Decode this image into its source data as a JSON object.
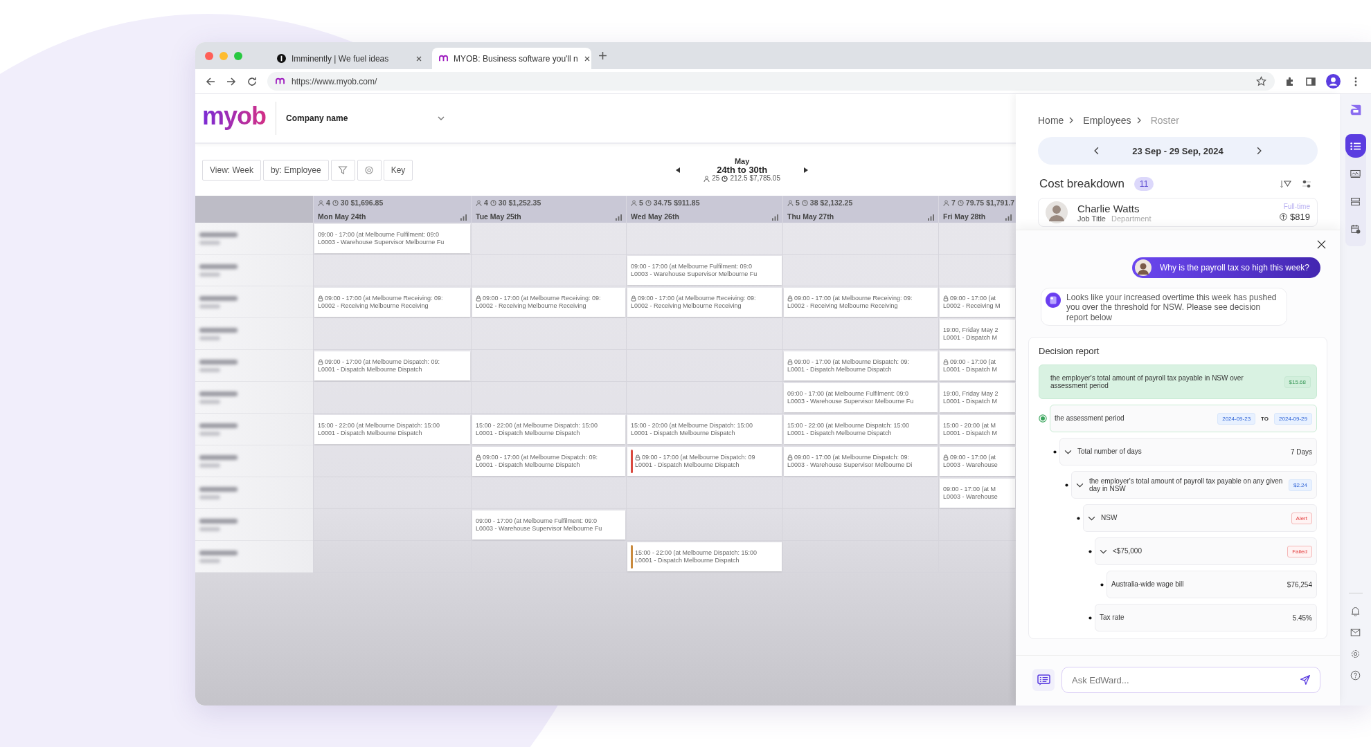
{
  "browser": {
    "tabs": [
      {
        "title": "Imminently | We fuel ideas",
        "selected": false
      },
      {
        "title": "MYOB: Business software you'll n",
        "selected": true
      }
    ],
    "url": "https://www.myob.com/"
  },
  "app": {
    "logo": "myob",
    "company": "Company name",
    "toolbar": {
      "view": "View: Week",
      "group": "by: Employee",
      "key": "Key",
      "month": "May",
      "range": "24th to 30th",
      "people": "25",
      "hours": "212.5",
      "cost": "$7,785.05"
    },
    "days": [
      {
        "people": "4",
        "hours": "30",
        "cost": "$1,696.85",
        "label": "Mon May 24th"
      },
      {
        "people": "4",
        "hours": "30",
        "cost": "$1,252.35",
        "label": "Tue May 25th"
      },
      {
        "people": "5",
        "hours": "34.75",
        "cost": "$911.85",
        "label": "Wed May 26th"
      },
      {
        "people": "5",
        "hours": "38",
        "cost": "$2,132.25",
        "label": "Thu May 27th"
      },
      {
        "people": "7",
        "hours": "79.75",
        "cost": "$1,791.7",
        "label": "Fri May 28th"
      }
    ],
    "rows": [
      {
        "cells": [
          {
            "kind": "shift",
            "locked": false,
            "line1": "09:00 - 17:00 (at Melbourne Fulfilment: 09:0",
            "line2": "L0003 - Warehouse Supervisor Melbourne Fu"
          },
          {
            "kind": "empty"
          },
          {
            "kind": "empty"
          },
          {
            "kind": "empty"
          },
          {
            "kind": "empty"
          }
        ]
      },
      {
        "cells": [
          {
            "kind": "empty"
          },
          {
            "kind": "empty"
          },
          {
            "kind": "shift",
            "locked": false,
            "line1": "09:00 - 17:00 (at Melbourne Fulfilment: 09:0",
            "line2": "L0003 - Warehouse Supervisor Melbourne Fu"
          },
          {
            "kind": "empty"
          },
          {
            "kind": "empty"
          }
        ]
      },
      {
        "cells": [
          {
            "kind": "shift",
            "locked": true,
            "line1": "09:00 - 17:00 (at Melbourne Receiving: 09:",
            "line2": "L0002 - Receiving Melbourne Receiving"
          },
          {
            "kind": "shift",
            "locked": true,
            "line1": "09:00 - 17:00 (at Melbourne Receiving: 09:",
            "line2": "L0002 - Receiving Melbourne Receiving"
          },
          {
            "kind": "shift",
            "locked": true,
            "line1": "09:00 - 17:00 (at Melbourne Receiving: 09:",
            "line2": "L0002 - Receiving Melbourne Receiving"
          },
          {
            "kind": "shift",
            "locked": true,
            "line1": "09:00 - 17:00 (at Melbourne Receiving: 09:",
            "line2": "L0002 - Receiving Melbourne Receiving"
          },
          {
            "kind": "shift",
            "locked": true,
            "line1": "09:00 - 17:00 (at",
            "line2": "L0002 - Receiving M"
          }
        ]
      },
      {
        "cells": [
          {
            "kind": "empty"
          },
          {
            "kind": "empty"
          },
          {
            "kind": "empty"
          },
          {
            "kind": "empty"
          },
          {
            "kind": "shift",
            "locked": false,
            "line1": "19:00, Friday May 2",
            "line2": "L0001 - Dispatch M"
          }
        ]
      },
      {
        "cells": [
          {
            "kind": "shift",
            "locked": true,
            "line1": "09:00 - 17:00 (at Melbourne Dispatch: 09:",
            "line2": "L0001 - Dispatch Melbourne Dispatch"
          },
          {
            "kind": "empty"
          },
          {
            "kind": "empty"
          },
          {
            "kind": "shift",
            "locked": true,
            "line1": "09:00 - 17:00 (at Melbourne Dispatch: 09:",
            "line2": "L0001 - Dispatch Melbourne Dispatch"
          },
          {
            "kind": "shift",
            "locked": true,
            "line1": "09:00 - 17:00 (at",
            "line2": "L0001 - Dispatch M"
          }
        ]
      },
      {
        "cells": [
          {
            "kind": "empty"
          },
          {
            "kind": "empty"
          },
          {
            "kind": "empty"
          },
          {
            "kind": "shift",
            "locked": false,
            "line1": "09:00 - 17:00 (at Melbourne Fulfilment: 09:0",
            "line2": "L0003 - Warehouse Supervisor Melbourne Fu"
          },
          {
            "kind": "shift",
            "locked": false,
            "line1": "19:00, Friday May 2",
            "line2": "L0001 - Dispatch M"
          }
        ]
      },
      {
        "cells": [
          {
            "kind": "shift",
            "locked": false,
            "line1": "15:00 - 22:00 (at Melbourne Dispatch: 15:00",
            "line2": "L0001 - Dispatch Melbourne Dispatch"
          },
          {
            "kind": "shift",
            "locked": false,
            "line1": "15:00 - 22:00 (at Melbourne Dispatch: 15:00",
            "line2": "L0001 - Dispatch Melbourne Dispatch"
          },
          {
            "kind": "shift",
            "locked": false,
            "line1": "15:00 - 20:00 (at Melbourne Dispatch: 15:00",
            "line2": "L0001 - Dispatch Melbourne Dispatch"
          },
          {
            "kind": "shift",
            "locked": false,
            "line1": "15:00 - 22:00 (at Melbourne Dispatch: 15:00",
            "line2": "L0001 - Dispatch Melbourne Dispatch"
          },
          {
            "kind": "shift",
            "locked": false,
            "line1": "15:00 - 20:00 (at M",
            "line2": "L0001 - Dispatch M"
          }
        ]
      },
      {
        "cells": [
          {
            "kind": "empty"
          },
          {
            "kind": "shift",
            "locked": true,
            "line1": "09:00 - 17:00 (at Melbourne Dispatch: 09:",
            "line2": "L0001 - Dispatch Melbourne Dispatch"
          },
          {
            "kind": "shift",
            "locked": true,
            "color": "#d9493f",
            "line1": "09:00 - 17:00 (at Melbourne Dispatch: 09",
            "line2": "L0001 - Dispatch Melbourne Dispatch"
          },
          {
            "kind": "shift",
            "locked": true,
            "line1": "09:00 - 17:00 (at Melbourne Dispatch: 09:",
            "line2": "L0003 - Warehouse Supervisor Melbourne Di"
          },
          {
            "kind": "shift",
            "locked": true,
            "line1": "09:00 - 17:00 (at",
            "line2": "L0003 - Warehouse"
          }
        ]
      },
      {
        "cells": [
          {
            "kind": "empty"
          },
          {
            "kind": "empty"
          },
          {
            "kind": "empty"
          },
          {
            "kind": "empty"
          },
          {
            "kind": "shift",
            "locked": false,
            "line1": "09:00 - 17:00 (at M",
            "line2": "L0003 - Warehouse"
          }
        ]
      },
      {
        "cells": [
          {
            "kind": "empty"
          },
          {
            "kind": "shift",
            "locked": false,
            "line1": "09:00 - 17:00 (at Melbourne Fulfilment: 09:0",
            "line2": "L0003 - Warehouse Supervisor Melbourne Fu"
          },
          {
            "kind": "empty"
          },
          {
            "kind": "empty"
          },
          {
            "kind": "empty"
          }
        ]
      },
      {
        "cells": [
          {
            "kind": "empty"
          },
          {
            "kind": "empty"
          },
          {
            "kind": "shift",
            "locked": false,
            "color": "#c98a3d",
            "line1": "15:00 - 22:00 (at Melbourne Dispatch: 15:00",
            "line2": "L0001 - Dispatch Melbourne Dispatch"
          },
          {
            "kind": "empty"
          },
          {
            "kind": "empty"
          }
        ]
      }
    ]
  },
  "panel": {
    "breadcrumbs": [
      {
        "label": "Home",
        "selected": false
      },
      {
        "label": "Employees",
        "selected": false
      },
      {
        "label": "Roster",
        "selected": true
      }
    ],
    "period": "23 Sep - 29 Sep, 2024",
    "title": "Cost breakdown",
    "count": "11",
    "employee": {
      "name": "Charlie Watts",
      "type": "Full-time",
      "job": "Job Title",
      "department": "Department",
      "cost": "$819"
    },
    "question": "Why is the payroll tax so high this week?",
    "answer": "Looks like your increased overtime this week has pushed you over the threshold for NSW. Please see decision report below",
    "report": {
      "title": "Decision report",
      "tree": {
        "kind": "total",
        "label": "the employer's total amount of payroll tax payable in NSW over assessment period",
        "value": "$15.68",
        "children": [
          {
            "kind": "period",
            "label": "the assessment period",
            "from": "2024-09-23",
            "joiner": "TO",
            "to": "2024-09-29",
            "children": [
              {
                "kind": "count",
                "label": "Total number of days",
                "value": "7 Days",
                "expanded": true,
                "children": [
                  {
                    "kind": "rate",
                    "label": "the employer's total amount of payroll tax payable on any given day in NSW",
                    "value": "$2.24",
                    "expanded": true,
                    "children": [
                      {
                        "kind": "status",
                        "label": "NSW",
                        "value": "Alert",
                        "expanded": true,
                        "children": [
                          {
                            "kind": "status",
                            "label": "<$75,000",
                            "value": "Failed",
                            "expanded": true,
                            "children": [
                              {
                                "kind": "count",
                                "label": "Australia-wide wage bill",
                                "value": "$76,254"
                              }
                            ]
                          },
                          {
                            "kind": "count",
                            "label": "Tax rate",
                            "value": "5.45%"
                          }
                        ]
                      }
                    ]
                  }
                ]
              }
            ]
          }
        ]
      }
    },
    "input_placeholder": "Ask EdWard..."
  },
  "rail": {
    "top": [
      {
        "kind": "list",
        "selected": true
      },
      {
        "kind": "chart",
        "selected": false
      },
      {
        "kind": "rows",
        "selected": false
      },
      {
        "kind": "calendar",
        "selected": false
      }
    ],
    "bottom": [
      {
        "kind": "bell"
      },
      {
        "kind": "mail"
      },
      {
        "kind": "settings"
      },
      {
        "kind": "help"
      }
    ]
  }
}
